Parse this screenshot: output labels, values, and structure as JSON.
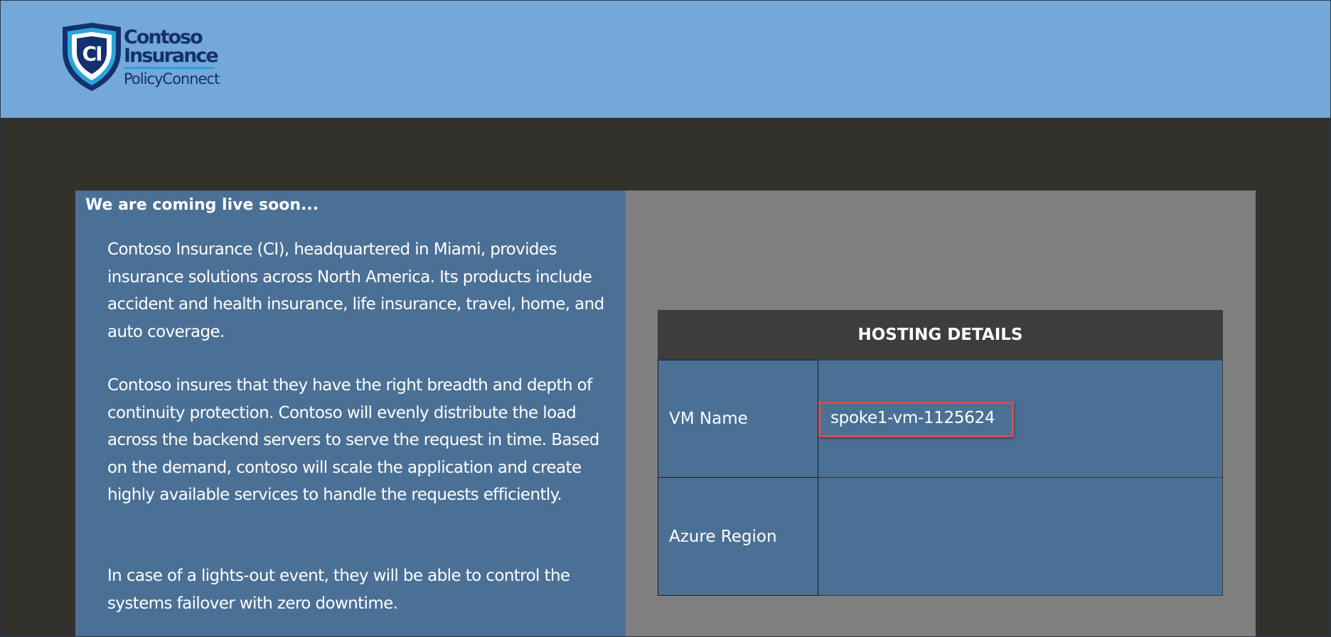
{
  "header": {
    "logo": {
      "emblem_text": "CI",
      "line1": "Contoso",
      "line2": "Insurance",
      "line3": "PolicyConnect",
      "colors": {
        "navy": "#14306e",
        "accent": "#29a5dc"
      }
    },
    "background_color": "#75a8da"
  },
  "intro": {
    "heading": "We are coming live soon...",
    "paragraphs": [
      "Contoso Insurance (CI), headquartered in Miami, provides insurance solutions across North America. Its products include accident and health insurance, life insurance, travel, home, and auto coverage.",
      "Contoso insures that they have the right breadth and depth of continuity protection. Contoso will evenly distribute the load across the backend servers to serve the request in time. Based on the demand, contoso will scale the application and create highly available services to handle the requests efficiently.",
      "In case of a lights-out event, they will be able to control the systems failover with zero downtime."
    ]
  },
  "hosting": {
    "title": "HOSTING DETAILS",
    "rows": [
      {
        "label": "VM Name",
        "value": "spoke1-vm-1125624",
        "highlighted": true
      },
      {
        "label": "Azure Region",
        "value": ""
      }
    ],
    "highlight_color": "#d05050"
  }
}
